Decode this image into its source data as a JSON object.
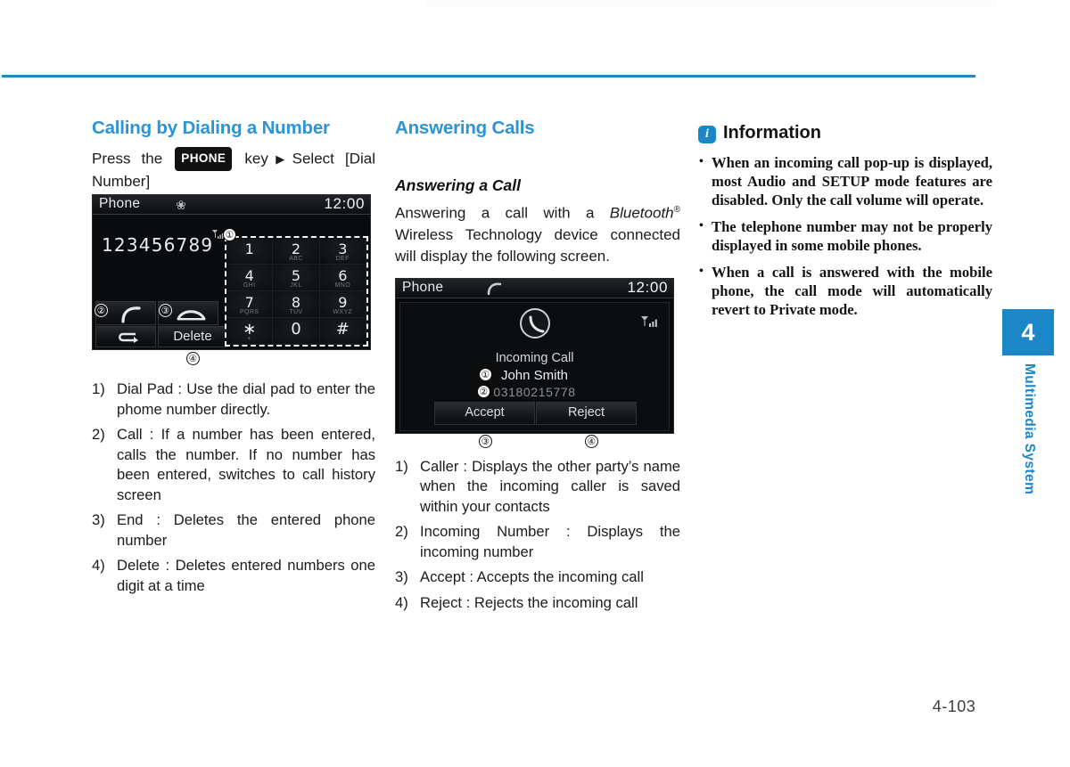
{
  "page": {
    "number": "4-103",
    "chapter_tab": "4",
    "chapter_label": "Multimedia System",
    "accent_color": "#2e93d1",
    "info_icon_color": "#1b87c9"
  },
  "column_left": {
    "title": "Calling by Dialing a Number",
    "intro": {
      "before_key": "Press the",
      "key_label": "PHONE",
      "after_key": "key",
      "arrow": "▶",
      "tail": "Select [Dial Number]"
    },
    "dial_screen": {
      "title": "Phone",
      "clock": "12:00",
      "bluetooth_icon": "bluetooth-icon",
      "entered_number": "123456789",
      "signal_icon": "signal-strength-icon",
      "keys": [
        {
          "digit": "1",
          "letters": ""
        },
        {
          "digit": "2",
          "letters": "ABC"
        },
        {
          "digit": "3",
          "letters": "DEF"
        },
        {
          "digit": "4",
          "letters": "GHI"
        },
        {
          "digit": "5",
          "letters": "JKL"
        },
        {
          "digit": "6",
          "letters": "MNO"
        },
        {
          "digit": "7",
          "letters": "PQRS"
        },
        {
          "digit": "8",
          "letters": "TUV"
        },
        {
          "digit": "9",
          "letters": "WXYZ"
        },
        {
          "digit": "∗",
          "letters": "+"
        },
        {
          "digit": "0",
          "letters": ""
        },
        {
          "digit": "#",
          "letters": ""
        }
      ],
      "delete_label": "Delete",
      "call_icon": "call-handset-icon",
      "end_icon": "end-call-icon",
      "back_icon": "back-arrow-icon",
      "callouts": {
        "one": "①",
        "two": "②",
        "three": "③",
        "four": "④"
      }
    },
    "list": [
      {
        "marker": "1)",
        "text": "Dial Pad : Use the dial pad to enter the phome number directly."
      },
      {
        "marker": "2)",
        "text": "Call : If a number has been entered, calls the number. If no number has been entered, switches to call history screen"
      },
      {
        "marker": "3)",
        "text": "End : Deletes the entered phone number"
      },
      {
        "marker": "4)",
        "text": "Delete : Deletes entered numbers one digit at a time"
      }
    ]
  },
  "column_middle": {
    "title": "Answering Calls",
    "subtitle": "Answering a Call",
    "paragraph_part1": "Answering a call with a ",
    "paragraph_bt": "Bluetooth",
    "paragraph_reg": "®",
    "paragraph_part2": " Wireless Technology device connected will display the following screen.",
    "incall_screen": {
      "title": "Phone",
      "clock": "12:00",
      "header_icon": "active-call-icon",
      "center_icon": "call-clock-icon",
      "signal_icon": "signal-strength-icon",
      "state": "Incoming Call",
      "caller_name": "John Smith",
      "caller_number": "03180215778",
      "accept_label": "Accept",
      "reject_label": "Reject",
      "callouts": {
        "one": "①",
        "two": "②",
        "three": "③",
        "four": "④"
      }
    },
    "list": [
      {
        "marker": "1)",
        "text": "Caller : Displays the other party’s name when the incoming caller is saved within your contacts"
      },
      {
        "marker": "2)",
        "text": "Incoming Number : Displays the incoming number"
      },
      {
        "marker": "3)",
        "text": "Accept : Accepts the incoming call"
      },
      {
        "marker": "4)",
        "text": "Reject : Rejects the incoming call"
      }
    ]
  },
  "column_right": {
    "info_icon_letter": "i",
    "info_title": "Information",
    "items": [
      "When an incoming call pop-up is displayed, most Audio and SETUP mode features are disabled. Only the call volume will operate.",
      "The telephone number may not be properly displayed in some mobile phones.",
      "When a call is answered with the mobile phone, the call mode will automatically revert to Private mode."
    ]
  }
}
